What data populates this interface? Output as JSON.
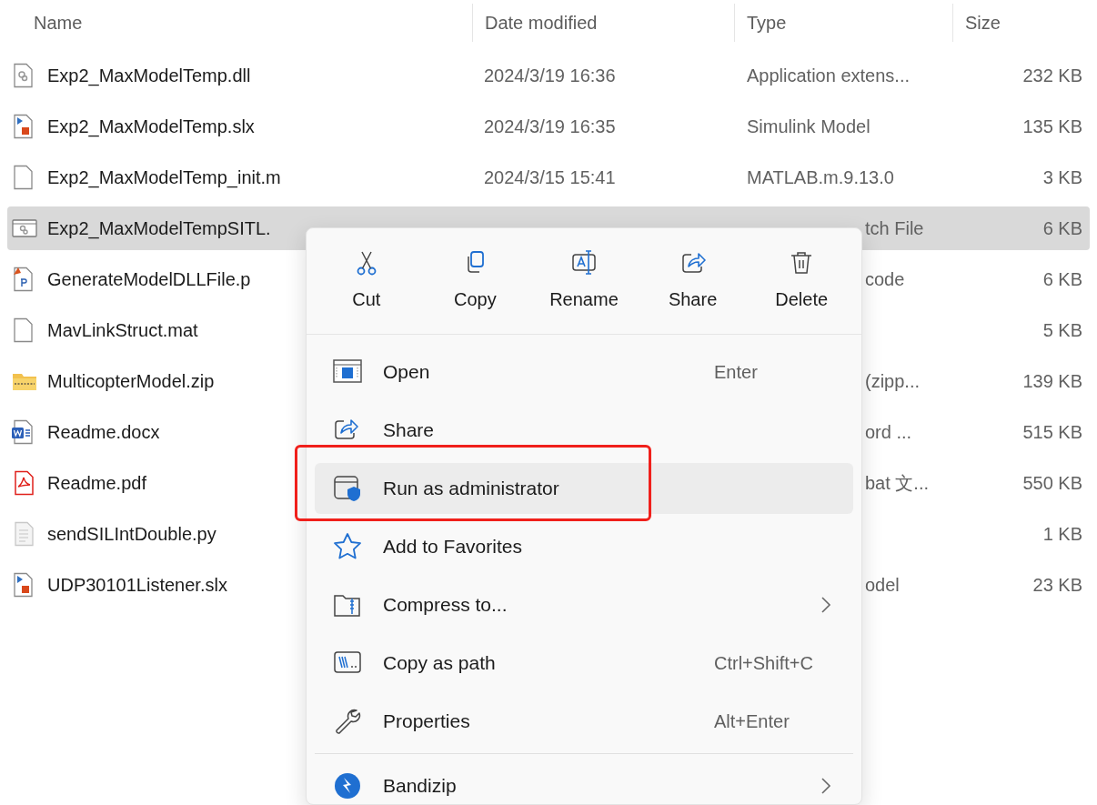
{
  "columns": [
    "Name",
    "Date modified",
    "Type",
    "Size"
  ],
  "files": [
    {
      "kind": "dll",
      "name": "Exp2_MaxModelTemp.dll",
      "date": "2024/3/19 16:36",
      "type": "Application extens...",
      "size": "232 KB",
      "selected": false
    },
    {
      "kind": "slx",
      "name": "Exp2_MaxModelTemp.slx",
      "date": "2024/3/19 16:35",
      "type": "Simulink Model",
      "size": "135 KB",
      "selected": false
    },
    {
      "kind": "m",
      "name": "Exp2_MaxModelTemp_init.m",
      "date": "2024/3/15 15:41",
      "type": "MATLAB.m.9.13.0",
      "size": "3 KB",
      "selected": false
    },
    {
      "kind": "bat",
      "name": "Exp2_MaxModelTempSITL.",
      "type": "tch File",
      "size": "6 KB",
      "selected": true
    },
    {
      "kind": "p",
      "name": "GenerateModelDLLFile.p",
      "type": "code",
      "size": "6 KB",
      "selected": false
    },
    {
      "kind": "mat",
      "name": "MavLinkStruct.mat",
      "size": "5 KB",
      "selected": false
    },
    {
      "kind": "zip",
      "name": "MulticopterModel.zip",
      "type": "(zipp...",
      "size": "139 KB",
      "selected": false
    },
    {
      "kind": "docx",
      "name": "Readme.docx",
      "type": "ord ...",
      "size": "515 KB",
      "selected": false
    },
    {
      "kind": "pdf",
      "name": "Readme.pdf",
      "type": "bat 文...",
      "size": "550 KB",
      "selected": false
    },
    {
      "kind": "py",
      "name": "sendSILIntDouble.py",
      "size": "1 KB",
      "selected": false
    },
    {
      "kind": "slx",
      "name": "UDP30101Listener.slx",
      "type": "odel",
      "size": "23 KB",
      "selected": false
    }
  ],
  "context_menu": {
    "actions": [
      {
        "kind": "cut",
        "label": "Cut"
      },
      {
        "kind": "copy",
        "label": "Copy"
      },
      {
        "kind": "rename",
        "label": "Rename"
      },
      {
        "kind": "share",
        "label": "Share"
      },
      {
        "kind": "delete",
        "label": "Delete"
      }
    ],
    "items": [
      {
        "kind": "open",
        "label": "Open",
        "shortcut": "Enter",
        "submenu": false,
        "hovered": false,
        "annotated": false
      },
      {
        "kind": "share",
        "label": "Share",
        "submenu": false,
        "hovered": false,
        "annotated": false
      },
      {
        "kind": "admin",
        "label": "Run as administrator",
        "submenu": false,
        "hovered": true,
        "annotated": true
      },
      {
        "kind": "star",
        "label": "Add to Favorites",
        "submenu": false,
        "hovered": false,
        "annotated": false
      },
      {
        "kind": "zipfolder",
        "label": "Compress to...",
        "submenu": true,
        "hovered": false,
        "annotated": false
      },
      {
        "kind": "path",
        "label": "Copy as path",
        "shortcut": "Ctrl+Shift+C",
        "submenu": false,
        "hovered": false,
        "annotated": false
      },
      {
        "kind": "wrench",
        "label": "Properties",
        "shortcut": "Alt+Enter",
        "submenu": false,
        "hovered": false,
        "annotated": false
      },
      {
        "kind": "separator"
      },
      {
        "kind": "bandizip",
        "label": "Bandizip",
        "submenu": true,
        "hovered": false,
        "annotated": false
      }
    ]
  }
}
